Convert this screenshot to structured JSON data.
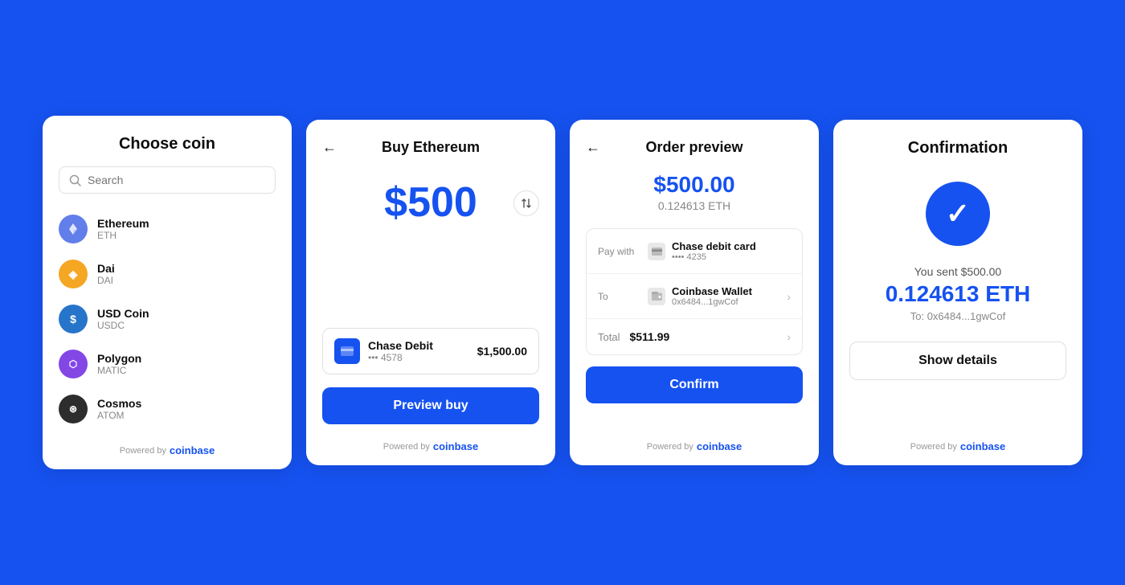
{
  "background_color": "#1652F0",
  "panel1": {
    "title": "Choose coin",
    "search_placeholder": "Search",
    "coins": [
      {
        "name": "Ethereum",
        "ticker": "ETH",
        "color": "eth",
        "symbol": "Ξ"
      },
      {
        "name": "Dai",
        "ticker": "DAI",
        "color": "dai",
        "symbol": "◈"
      },
      {
        "name": "USD Coin",
        "ticker": "USDC",
        "color": "usdc",
        "symbol": "$"
      },
      {
        "name": "Polygon",
        "ticker": "MATIC",
        "color": "matic",
        "symbol": "⬡"
      },
      {
        "name": "Cosmos",
        "ticker": "ATOM",
        "color": "atom",
        "symbol": "⊛"
      }
    ],
    "footer_powered": "Powered by",
    "footer_brand": "coinbase"
  },
  "panel2": {
    "title": "Buy Ethereum",
    "back_label": "←",
    "amount": "$500",
    "payment_name": "Chase Debit",
    "payment_card": "••• 4578",
    "payment_amount": "$1,500.00",
    "preview_btn": "Preview buy",
    "footer_powered": "Powered by",
    "footer_brand": "coinbase"
  },
  "panel3": {
    "title": "Order preview",
    "back_label": "←",
    "order_usd": "$500.00",
    "order_eth": "0.124613 ETH",
    "pay_with_label": "Pay with",
    "pay_with_name": "Chase debit card",
    "pay_with_card": "•••• 4235",
    "to_label": "To",
    "to_wallet": "Coinbase Wallet",
    "to_address": "0x6484...1gwCof",
    "total_label": "Total",
    "total_amount": "$511.99",
    "confirm_btn": "Confirm",
    "footer_powered": "Powered by",
    "footer_brand": "coinbase"
  },
  "panel4": {
    "title": "Confirmation",
    "sent_text": "You sent $500.00",
    "eth_amount": "0.124613 ETH",
    "to_address": "To: 0x6484...1gwCof",
    "show_details_btn": "Show details",
    "footer_powered": "Powered by",
    "footer_brand": "coinbase"
  }
}
